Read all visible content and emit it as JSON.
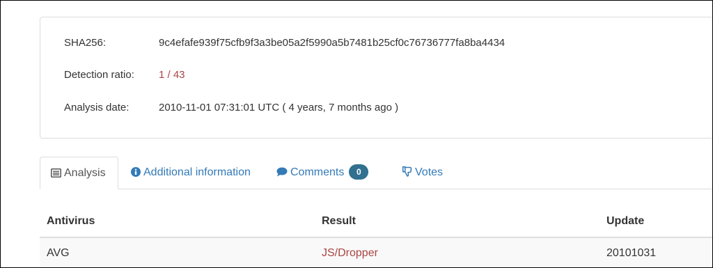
{
  "summary": {
    "sha256_label": "SHA256:",
    "sha256_value": "9c4efafe939f75cfb9f3a3be05a2f5990a5b7481b25cf0c76736777fa8ba4434",
    "ratio_label": "Detection ratio:",
    "ratio_value": "1 / 43",
    "date_label": "Analysis date:",
    "date_value": "2010-11-01 07:31:01 UTC ( 4 years, 7 months ago )"
  },
  "tabs": [
    {
      "label": "Analysis",
      "icon": "list-icon",
      "active": true
    },
    {
      "label": "Additional information",
      "icon": "info-circle-icon"
    },
    {
      "label": "Comments",
      "icon": "comment-icon",
      "badge": "0"
    },
    {
      "label": "Votes",
      "icon": "thumbs-down-icon"
    }
  ],
  "table": {
    "headers": [
      "Antivirus",
      "Result",
      "Update"
    ],
    "rows": [
      {
        "antivirus": "AVG",
        "result": "JS/Dropper",
        "update": "20101031"
      }
    ]
  },
  "colors": {
    "link": "#337ab7",
    "alert": "#a94442",
    "badge": "#31708f",
    "border": "#dddddd"
  }
}
